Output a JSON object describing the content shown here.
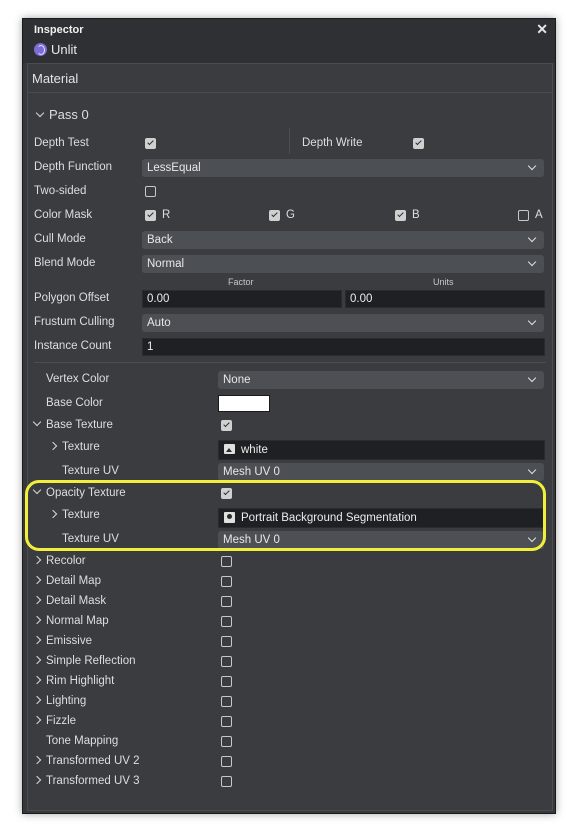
{
  "window": {
    "title": "Inspector",
    "subtitle": "Unlit",
    "close": "✕"
  },
  "material": {
    "header": "Material"
  },
  "pass": {
    "label": "Pass 0"
  },
  "depth_test": {
    "label": "Depth Test",
    "checked": true
  },
  "depth_write": {
    "label": "Depth Write",
    "checked": true
  },
  "depth_function": {
    "label": "Depth Function",
    "value": "LessEqual"
  },
  "two_sided": {
    "label": "Two-sided",
    "checked": false
  },
  "color_mask": {
    "label": "Color Mask",
    "r": "R",
    "g": "G",
    "b": "B",
    "a": "A"
  },
  "cull_mode": {
    "label": "Cull Mode",
    "value": "Back"
  },
  "blend_mode": {
    "label": "Blend Mode",
    "value": "Normal"
  },
  "polygon_offset": {
    "label": "Polygon Offset",
    "factor_label": "Factor",
    "units_label": "Units",
    "factor": "0.00",
    "units": "0.00"
  },
  "frustum_culling": {
    "label": "Frustum Culling",
    "value": "Auto"
  },
  "instance_count": {
    "label": "Instance Count",
    "value": "1"
  },
  "vertex_color": {
    "label": "Vertex Color",
    "value": "None"
  },
  "base_color": {
    "label": "Base Color",
    "color": "#ffffff"
  },
  "base_texture": {
    "label": "Base Texture",
    "texture_label": "Texture",
    "texture_value": "white",
    "uv_label": "Texture UV",
    "uv_value": "Mesh UV 0"
  },
  "opacity_texture": {
    "label": "Opacity Texture",
    "texture_label": "Texture",
    "texture_value": "Portrait Background Segmentation",
    "uv_label": "Texture UV",
    "uv_value": "Mesh UV 0"
  },
  "options": [
    {
      "label": "Recolor",
      "expandable": true
    },
    {
      "label": "Detail Map",
      "expandable": true
    },
    {
      "label": "Detail Mask",
      "expandable": true
    },
    {
      "label": "Normal Map",
      "expandable": true
    },
    {
      "label": "Emissive",
      "expandable": true
    },
    {
      "label": "Simple Reflection",
      "expandable": true
    },
    {
      "label": "Rim Highlight",
      "expandable": true
    },
    {
      "label": "Lighting",
      "expandable": true
    },
    {
      "label": "Fizzle",
      "expandable": true
    },
    {
      "label": "Tone Mapping",
      "expandable": false
    },
    {
      "label": "Transformed UV 2",
      "expandable": true
    },
    {
      "label": "Transformed UV 3",
      "expandable": true
    }
  ],
  "colors": {
    "highlight": "#f2ef3a",
    "panel": "#3a3c40"
  }
}
